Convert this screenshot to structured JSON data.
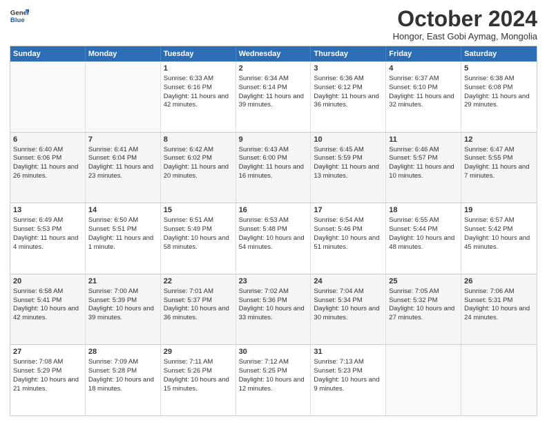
{
  "header": {
    "logo_line1": "General",
    "logo_line2": "Blue",
    "month": "October 2024",
    "location": "Hongor, East Gobi Aymag, Mongolia"
  },
  "weekdays": [
    "Sunday",
    "Monday",
    "Tuesday",
    "Wednesday",
    "Thursday",
    "Friday",
    "Saturday"
  ],
  "weeks": [
    [
      {
        "day": "",
        "sunrise": "",
        "sunset": "",
        "daylight": ""
      },
      {
        "day": "",
        "sunrise": "",
        "sunset": "",
        "daylight": ""
      },
      {
        "day": "1",
        "sunrise": "Sunrise: 6:33 AM",
        "sunset": "Sunset: 6:16 PM",
        "daylight": "Daylight: 11 hours and 42 minutes."
      },
      {
        "day": "2",
        "sunrise": "Sunrise: 6:34 AM",
        "sunset": "Sunset: 6:14 PM",
        "daylight": "Daylight: 11 hours and 39 minutes."
      },
      {
        "day": "3",
        "sunrise": "Sunrise: 6:36 AM",
        "sunset": "Sunset: 6:12 PM",
        "daylight": "Daylight: 11 hours and 36 minutes."
      },
      {
        "day": "4",
        "sunrise": "Sunrise: 6:37 AM",
        "sunset": "Sunset: 6:10 PM",
        "daylight": "Daylight: 11 hours and 32 minutes."
      },
      {
        "day": "5",
        "sunrise": "Sunrise: 6:38 AM",
        "sunset": "Sunset: 6:08 PM",
        "daylight": "Daylight: 11 hours and 29 minutes."
      }
    ],
    [
      {
        "day": "6",
        "sunrise": "Sunrise: 6:40 AM",
        "sunset": "Sunset: 6:06 PM",
        "daylight": "Daylight: 11 hours and 26 minutes."
      },
      {
        "day": "7",
        "sunrise": "Sunrise: 6:41 AM",
        "sunset": "Sunset: 6:04 PM",
        "daylight": "Daylight: 11 hours and 23 minutes."
      },
      {
        "day": "8",
        "sunrise": "Sunrise: 6:42 AM",
        "sunset": "Sunset: 6:02 PM",
        "daylight": "Daylight: 11 hours and 20 minutes."
      },
      {
        "day": "9",
        "sunrise": "Sunrise: 6:43 AM",
        "sunset": "Sunset: 6:00 PM",
        "daylight": "Daylight: 11 hours and 16 minutes."
      },
      {
        "day": "10",
        "sunrise": "Sunrise: 6:45 AM",
        "sunset": "Sunset: 5:59 PM",
        "daylight": "Daylight: 11 hours and 13 minutes."
      },
      {
        "day": "11",
        "sunrise": "Sunrise: 6:46 AM",
        "sunset": "Sunset: 5:57 PM",
        "daylight": "Daylight: 11 hours and 10 minutes."
      },
      {
        "day": "12",
        "sunrise": "Sunrise: 6:47 AM",
        "sunset": "Sunset: 5:55 PM",
        "daylight": "Daylight: 11 hours and 7 minutes."
      }
    ],
    [
      {
        "day": "13",
        "sunrise": "Sunrise: 6:49 AM",
        "sunset": "Sunset: 5:53 PM",
        "daylight": "Daylight: 11 hours and 4 minutes."
      },
      {
        "day": "14",
        "sunrise": "Sunrise: 6:50 AM",
        "sunset": "Sunset: 5:51 PM",
        "daylight": "Daylight: 11 hours and 1 minute."
      },
      {
        "day": "15",
        "sunrise": "Sunrise: 6:51 AM",
        "sunset": "Sunset: 5:49 PM",
        "daylight": "Daylight: 10 hours and 58 minutes."
      },
      {
        "day": "16",
        "sunrise": "Sunrise: 6:53 AM",
        "sunset": "Sunset: 5:48 PM",
        "daylight": "Daylight: 10 hours and 54 minutes."
      },
      {
        "day": "17",
        "sunrise": "Sunrise: 6:54 AM",
        "sunset": "Sunset: 5:46 PM",
        "daylight": "Daylight: 10 hours and 51 minutes."
      },
      {
        "day": "18",
        "sunrise": "Sunrise: 6:55 AM",
        "sunset": "Sunset: 5:44 PM",
        "daylight": "Daylight: 10 hours and 48 minutes."
      },
      {
        "day": "19",
        "sunrise": "Sunrise: 6:57 AM",
        "sunset": "Sunset: 5:42 PM",
        "daylight": "Daylight: 10 hours and 45 minutes."
      }
    ],
    [
      {
        "day": "20",
        "sunrise": "Sunrise: 6:58 AM",
        "sunset": "Sunset: 5:41 PM",
        "daylight": "Daylight: 10 hours and 42 minutes."
      },
      {
        "day": "21",
        "sunrise": "Sunrise: 7:00 AM",
        "sunset": "Sunset: 5:39 PM",
        "daylight": "Daylight: 10 hours and 39 minutes."
      },
      {
        "day": "22",
        "sunrise": "Sunrise: 7:01 AM",
        "sunset": "Sunset: 5:37 PM",
        "daylight": "Daylight: 10 hours and 36 minutes."
      },
      {
        "day": "23",
        "sunrise": "Sunrise: 7:02 AM",
        "sunset": "Sunset: 5:36 PM",
        "daylight": "Daylight: 10 hours and 33 minutes."
      },
      {
        "day": "24",
        "sunrise": "Sunrise: 7:04 AM",
        "sunset": "Sunset: 5:34 PM",
        "daylight": "Daylight: 10 hours and 30 minutes."
      },
      {
        "day": "25",
        "sunrise": "Sunrise: 7:05 AM",
        "sunset": "Sunset: 5:32 PM",
        "daylight": "Daylight: 10 hours and 27 minutes."
      },
      {
        "day": "26",
        "sunrise": "Sunrise: 7:06 AM",
        "sunset": "Sunset: 5:31 PM",
        "daylight": "Daylight: 10 hours and 24 minutes."
      }
    ],
    [
      {
        "day": "27",
        "sunrise": "Sunrise: 7:08 AM",
        "sunset": "Sunset: 5:29 PM",
        "daylight": "Daylight: 10 hours and 21 minutes."
      },
      {
        "day": "28",
        "sunrise": "Sunrise: 7:09 AM",
        "sunset": "Sunset: 5:28 PM",
        "daylight": "Daylight: 10 hours and 18 minutes."
      },
      {
        "day": "29",
        "sunrise": "Sunrise: 7:11 AM",
        "sunset": "Sunset: 5:26 PM",
        "daylight": "Daylight: 10 hours and 15 minutes."
      },
      {
        "day": "30",
        "sunrise": "Sunrise: 7:12 AM",
        "sunset": "Sunset: 5:25 PM",
        "daylight": "Daylight: 10 hours and 12 minutes."
      },
      {
        "day": "31",
        "sunrise": "Sunrise: 7:13 AM",
        "sunset": "Sunset: 5:23 PM",
        "daylight": "Daylight: 10 hours and 9 minutes."
      },
      {
        "day": "",
        "sunrise": "",
        "sunset": "",
        "daylight": ""
      },
      {
        "day": "",
        "sunrise": "",
        "sunset": "",
        "daylight": ""
      }
    ]
  ]
}
